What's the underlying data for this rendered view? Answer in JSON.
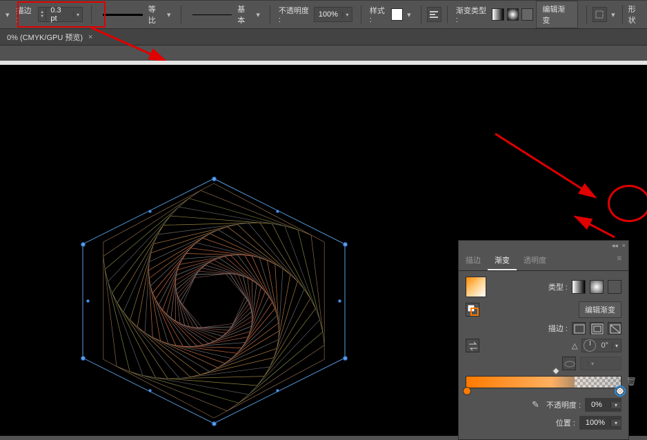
{
  "topbar": {
    "stroke_label": "描边 :",
    "stroke_value": "0.3 pt",
    "profile_label": "等比",
    "brush_label": "基本",
    "opacity_label": "不透明度 :",
    "opacity_value": "100%",
    "style_label": "样式 :",
    "gradient_type_label": "渐变类型 :",
    "edit_gradient_label": "编辑渐变",
    "shape_label": "形状"
  },
  "tab": {
    "title": "0% (CMYK/GPU 预览)",
    "close": "×"
  },
  "panel": {
    "tabs": {
      "stroke": "描边",
      "gradient": "渐变",
      "opacity": "透明度"
    },
    "type_label": "类型 :",
    "edit_gradient": "编辑渐变",
    "stroke_label": "描边 :",
    "angle_value": "0°",
    "opacity_label": "不透明度 :",
    "opacity_value": "0%",
    "location_label": "位置 :",
    "location_value": "100%"
  },
  "icons": {
    "menu": "≡",
    "collapse_left": "◂◂",
    "close": "×",
    "chevron_down": "▾",
    "angle": "△"
  }
}
